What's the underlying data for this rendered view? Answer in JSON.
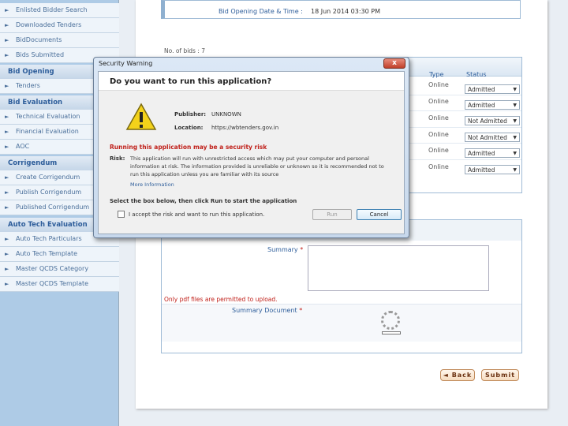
{
  "sidebar": {
    "items_top": [
      "Enlisted Bidder Search",
      "Downloaded Tenders",
      "BidDocuments",
      "Bids Submitted"
    ],
    "head_bid_opening": "Bid Opening",
    "items_bid_opening": [
      "Tenders"
    ],
    "head_bid_evaluation": "Bid Evaluation",
    "items_bid_evaluation": [
      "Technical Evaluation",
      "Financial Evaluation",
      "AOC"
    ],
    "head_corrigendum": "Corrigendum",
    "items_corrigendum": [
      "Create Corrigendum",
      "Publish Corrigendum",
      "Published Corrigendum"
    ],
    "head_auto_tech": "Auto Tech Evaluation",
    "items_auto_tech": [
      "Auto Tech Particulars",
      "Auto Tech Template",
      "Master QCDS Category",
      "Master QCDS Template"
    ]
  },
  "main": {
    "bid_opening_label": "Bid Opening Date & Time :",
    "bid_opening_value": "18 Jun 2014 03:30 PM",
    "no_of_bids": "No. of bids : 7",
    "col_type": "Type",
    "col_status": "Status",
    "rows": [
      {
        "type": "Online",
        "status": "Admitted"
      },
      {
        "type": "Online",
        "status": "Admitted"
      },
      {
        "type": "Online",
        "status": "Not Admitted"
      },
      {
        "type": "Online",
        "status": "Not Admitted"
      },
      {
        "type": "Online",
        "status": "Admitted"
      },
      {
        "type": "Online",
        "status": "Admitted"
      }
    ],
    "summary_label": "Summary",
    "required_mark": "*",
    "pdf_note": "Only pdf files are permitted to upload.",
    "summary_doc_label": "Summary Document",
    "back_label": "Back",
    "submit_label": "Submit"
  },
  "dialog": {
    "title": "Security Warning",
    "close": "x",
    "question": "Do you want to run this application?",
    "publisher_label": "Publisher:",
    "publisher_value": "UNKNOWN",
    "location_label": "Location:",
    "location_value": "https://wbtenders.gov.in",
    "risk_heading": "Running this application may be a security risk",
    "risk_label": "Risk:",
    "risk_lines": [
      "This application will run with unrestricted access which may put your computer and personal",
      "information at risk. The information provided is unreliable or unknown so it is recommended not to",
      "run this application unless you are familiar with its source"
    ],
    "more_info": "More Information",
    "instruction": "Select the box below, then click Run to start the application",
    "accept_label": "I accept the risk and want to run this application.",
    "run_label": "Run",
    "cancel_label": "Cancel"
  },
  "colors": {
    "sidebar_bg": "#aecbe6",
    "link": "#2d5d9a",
    "warning_red": "#c0201a",
    "accent_orange": "#c08a5a"
  }
}
